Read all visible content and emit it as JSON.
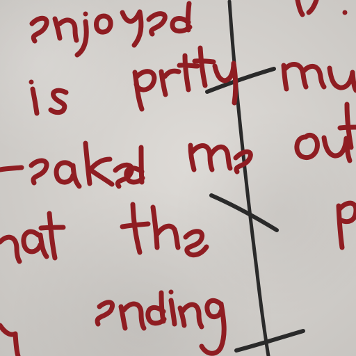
{
  "photo": {
    "words": {
      "enjoyed": "enjoyed",
      "is": "is",
      "pretty": "pretty",
      "freaked": "freaked",
      "me": "me",
      "that": "that",
      "the": "the",
      "ending": "ending",
      "y": "y",
      "much": "much",
      "out": "out",
      "p": "p"
    },
    "colors": {
      "paper": "#d7d4d0",
      "ink_red": "#8f1d22",
      "ink_dark": "#2a2a2a"
    }
  }
}
